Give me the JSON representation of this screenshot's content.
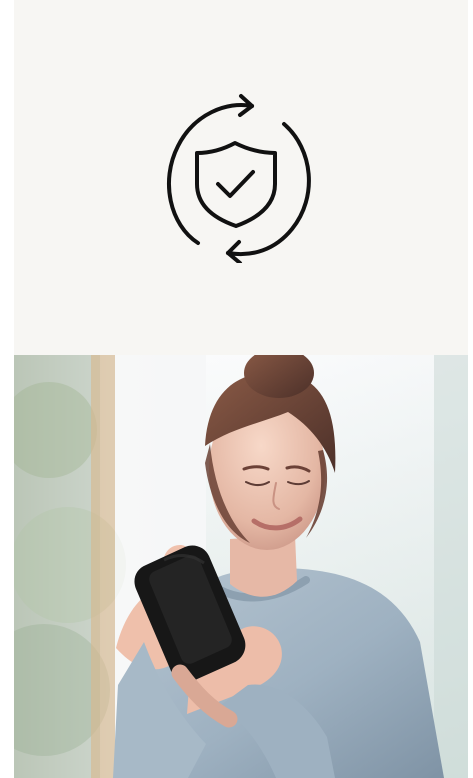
{
  "card": {
    "icon": "shield-check-sync-icon",
    "background": "#f7f6f3",
    "icon_color": "#111111"
  },
  "photo": {
    "subject": "woman-using-smartphone",
    "sweater_color": "#9eb1c1",
    "phone_color": "#171717"
  }
}
